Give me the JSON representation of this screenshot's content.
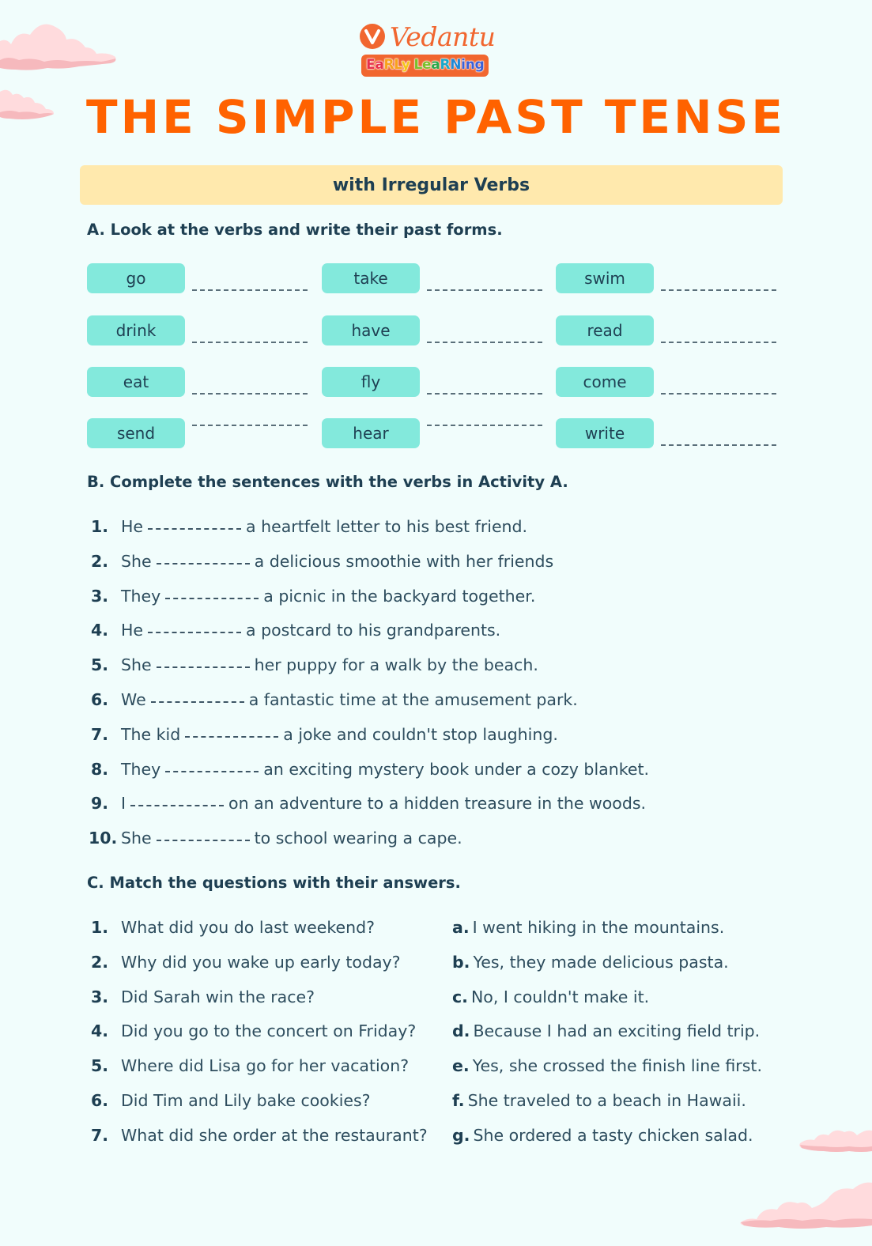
{
  "brand": {
    "name": "Vedantu",
    "badge_letters": [
      {
        "ch": "E",
        "color": "#e8304a"
      },
      {
        "ch": "a",
        "color": "#e8304a"
      },
      {
        "ch": "R",
        "color": "#f7a21b"
      },
      {
        "ch": "L",
        "color": "#f7a21b"
      },
      {
        "ch": "y",
        "color": "#f5c518"
      },
      {
        "ch": " ",
        "color": "#ffffff"
      },
      {
        "ch": "L",
        "color": "#7bbf2a"
      },
      {
        "ch": "e",
        "color": "#7bbf2a"
      },
      {
        "ch": "a",
        "color": "#2aa84a"
      },
      {
        "ch": "R",
        "color": "#1aa7c9"
      },
      {
        "ch": "N",
        "color": "#1e88d6"
      },
      {
        "ch": "i",
        "color": "#3b5fd6"
      },
      {
        "ch": "n",
        "color": "#3b5fd6"
      },
      {
        "ch": "g",
        "color": "#3b5fd6"
      }
    ],
    "badge_text": "EaRLy LeaRNing",
    "accent_color": "#f1662f"
  },
  "title": "THE SIMPLE PAST TENSE",
  "subtitle": "with Irregular Verbs",
  "section_a": {
    "heading": "A. Look at the verbs and write their past forms.",
    "verbs": [
      "go",
      "take",
      "swim",
      "drink",
      "have",
      "read",
      "eat",
      "fly",
      "come",
      "send",
      "hear",
      "write"
    ]
  },
  "section_b": {
    "heading": "B. Complete the sentences with the verbs in Activity A.",
    "items": [
      {
        "num": "1.",
        "before": "He",
        "after": "a heartfelt letter to his best friend."
      },
      {
        "num": "2.",
        "before": "She",
        "after": "a delicious smoothie with her friends"
      },
      {
        "num": "3.",
        "before": "They",
        "after": "a picnic in the backyard together."
      },
      {
        "num": "4.",
        "before": "He",
        "after": "a postcard to his grandparents."
      },
      {
        "num": "5.",
        "before": "She",
        "after": "her puppy for a walk by the beach."
      },
      {
        "num": "6.",
        "before": "We",
        "after": "a fantastic time at the amusement park."
      },
      {
        "num": "7.",
        "before": "The kid",
        "after": "a joke and couldn't stop laughing."
      },
      {
        "num": "8.",
        "before": "They",
        "after": "an exciting mystery book under a cozy blanket."
      },
      {
        "num": "9.",
        "before": "I",
        "after": "on an adventure to a hidden treasure in the woods."
      },
      {
        "num": "10.",
        "before": "She",
        "after": "to school wearing a cape."
      }
    ]
  },
  "section_c": {
    "heading": "C. Match the questions with their answers.",
    "questions": [
      {
        "num": "1.",
        "text": "What did you do last weekend?"
      },
      {
        "num": "2.",
        "text": "Why did you wake up early today?"
      },
      {
        "num": "3.",
        "text": "Did Sarah win the race?"
      },
      {
        "num": "4.",
        "text": "Did you go to the concert on Friday?"
      },
      {
        "num": "5.",
        "text": "Where did Lisa go for her vacation?"
      },
      {
        "num": "6.",
        "text": "Did Tim and Lily bake cookies?"
      },
      {
        "num": "7.",
        "text": "What did she order at the restaurant?"
      }
    ],
    "answers": [
      {
        "letter": "a.",
        "text": "I went hiking in the mountains."
      },
      {
        "letter": "b.",
        "text": "Yes, they made delicious pasta."
      },
      {
        "letter": "c.",
        "text": "No, I couldn't make it."
      },
      {
        "letter": "d.",
        "text": "Because I had an exciting field trip."
      },
      {
        "letter": "e.",
        "text": "Yes, she crossed the finish line first."
      },
      {
        "letter": "f.",
        "text": "She traveled to a beach in Hawaii."
      },
      {
        "letter": "g.",
        "text": "She ordered a tasty chicken salad."
      }
    ]
  }
}
